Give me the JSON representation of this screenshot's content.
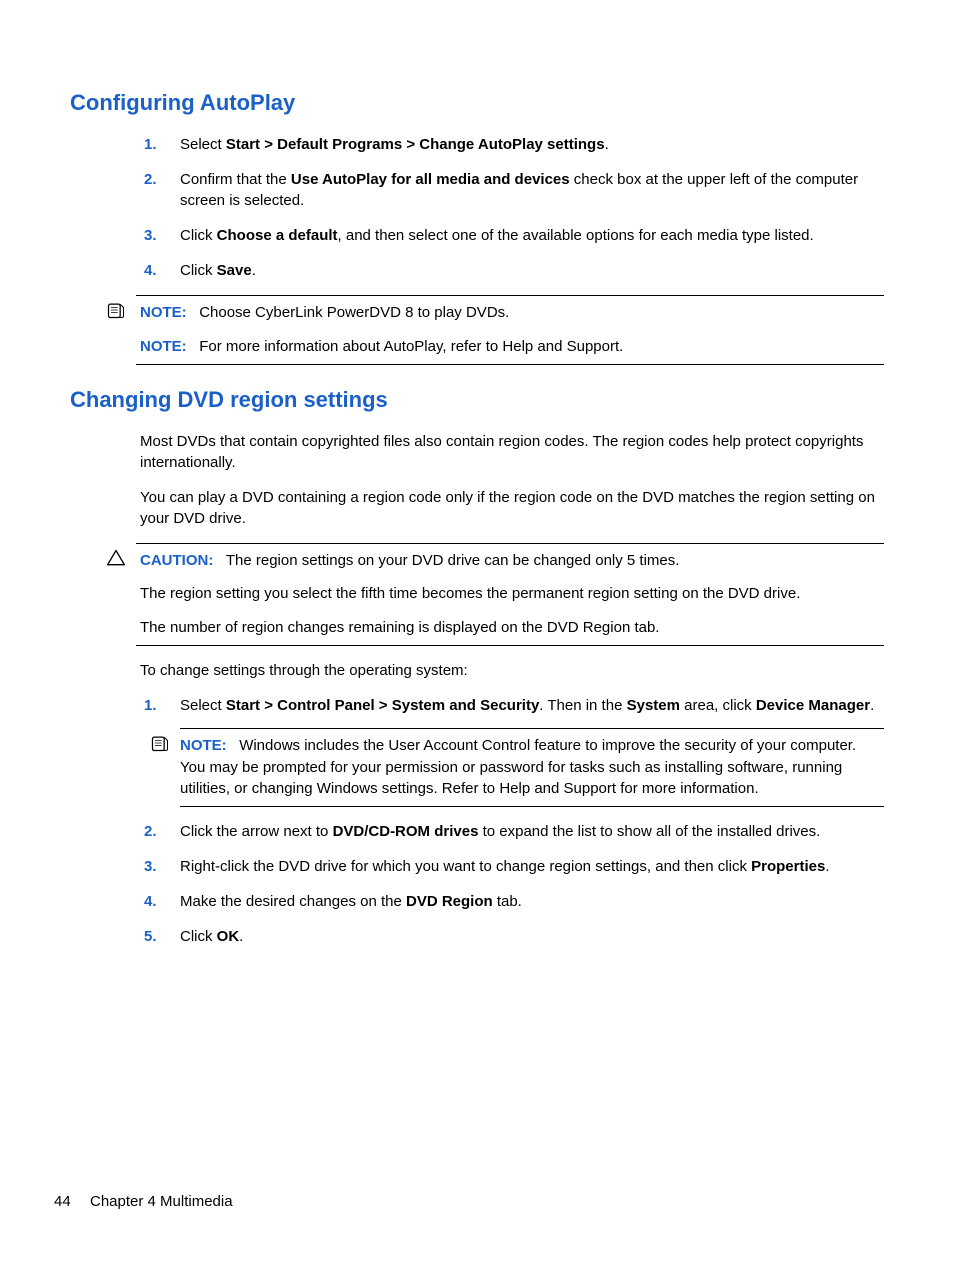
{
  "section1": {
    "heading": "Configuring AutoPlay",
    "steps": [
      {
        "pre": "Select ",
        "bold": "Start > Default Programs > Change AutoPlay settings",
        "post": "."
      },
      {
        "pre": "Confirm that the ",
        "bold": "Use AutoPlay for all media and devices",
        "post": " check box at the upper left of the computer screen is selected."
      },
      {
        "pre": "Click ",
        "bold": "Choose a default",
        "post": ", and then select one of the available options for each media type listed."
      },
      {
        "pre": "Click ",
        "bold": "Save",
        "post": "."
      }
    ],
    "note1": {
      "label": "NOTE:",
      "text": "Choose CyberLink PowerDVD 8 to play DVDs."
    },
    "note2": {
      "label": "NOTE:",
      "text": "For more information about AutoPlay, refer to Help and Support."
    }
  },
  "section2": {
    "heading": "Changing DVD region settings",
    "para1": "Most DVDs that contain copyrighted files also contain region codes. The region codes help protect copyrights internationally.",
    "para2": "You can play a DVD containing a region code only if the region code on the DVD matches the region setting on your DVD drive.",
    "caution": {
      "label": "CAUTION:",
      "text": "The region settings on your DVD drive can be changed only 5 times.",
      "body1": "The region setting you select the fifth time becomes the permanent region setting on the DVD drive.",
      "body2": "The number of region changes remaining is displayed on the DVD Region tab."
    },
    "para3": "To change settings through the operating system:",
    "steps": [
      {
        "pre": "Select ",
        "bold1": "Start > Control Panel > System and Security",
        "mid": ". Then in the ",
        "bold2": "System",
        "mid2": " area, click ",
        "bold3": "Device Manager",
        "post": "."
      },
      {
        "note": {
          "label": "NOTE:",
          "text": "Windows includes the User Account Control feature to improve the security of your computer. You may be prompted for your permission or password for tasks such as installing software, running utilities, or changing Windows settings. Refer to Help and Support for more information."
        }
      },
      {
        "pre": "Click the arrow next to ",
        "bold": "DVD/CD-ROM drives",
        "post": " to expand the list to show all of the installed drives."
      },
      {
        "pre": "Right-click the DVD drive for which you want to change region settings, and then click ",
        "bold": "Properties",
        "post": "."
      },
      {
        "pre": "Make the desired changes on the ",
        "bold": "DVD Region",
        "post": " tab."
      },
      {
        "pre": "Click ",
        "bold": "OK",
        "post": "."
      }
    ]
  },
  "footer": {
    "page": "44",
    "chapter": "Chapter 4   Multimedia"
  }
}
